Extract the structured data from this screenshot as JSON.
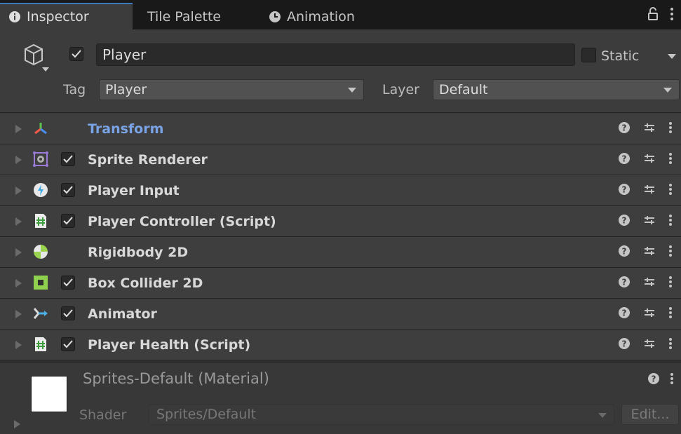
{
  "tabs": [
    {
      "label": "Inspector",
      "icon": "info-icon",
      "active": true
    },
    {
      "label": "Tile Palette",
      "active": false
    },
    {
      "label": "Animation",
      "icon": "clock-icon",
      "active": false
    }
  ],
  "header": {
    "object_icon": "cube-icon",
    "active": true,
    "name": "Player",
    "static_label": "Static",
    "static_checked": false,
    "tag_label": "Tag",
    "tag_value": "Player",
    "layer_label": "Layer",
    "layer_value": "Default"
  },
  "components": [
    {
      "name": "Transform",
      "icon": "transform-axes-icon",
      "has_checkbox": false,
      "enabled": true
    },
    {
      "name": "Sprite Renderer",
      "icon": "sprite-renderer-icon",
      "has_checkbox": true,
      "enabled": true
    },
    {
      "name": "Player Input",
      "icon": "player-input-icon",
      "has_checkbox": true,
      "enabled": true
    },
    {
      "name": "Player Controller (Script)",
      "icon": "csharp-script-icon",
      "has_checkbox": true,
      "enabled": true
    },
    {
      "name": "Rigidbody 2D",
      "icon": "rigidbody2d-icon",
      "has_checkbox": false,
      "enabled": true
    },
    {
      "name": "Box Collider 2D",
      "icon": "box-collider-icon",
      "has_checkbox": true,
      "enabled": true
    },
    {
      "name": "Animator",
      "icon": "animator-icon",
      "has_checkbox": true,
      "enabled": true
    },
    {
      "name": "Player Health (Script)",
      "icon": "csharp-script-icon",
      "has_checkbox": true,
      "enabled": true
    }
  ],
  "material": {
    "title": "Sprites-Default (Material)",
    "shader_label": "Shader",
    "shader_value": "Sprites/Default",
    "edit_label": "Edit..."
  },
  "colors": {
    "accent_blue": "#3a79bb",
    "transform_label": "#7aa3e5",
    "panel_bg": "#383838",
    "tabbar_bg": "#191919"
  }
}
